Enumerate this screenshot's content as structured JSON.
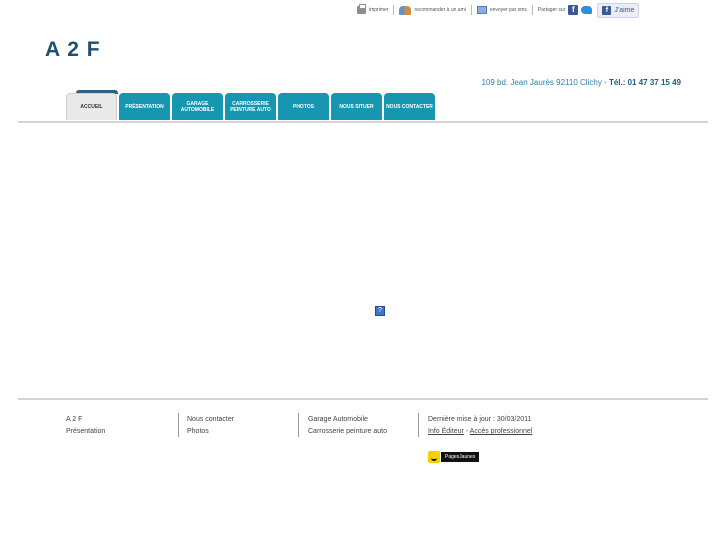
{
  "toolbar": {
    "print_label": "imprimer",
    "recommend_label": "recommander à un ami",
    "email_label": "envoyer par sms",
    "share_label": "Partager sur",
    "like_label": "J'aime",
    "facebook_letter": "f"
  },
  "site": {
    "logo": "A 2 F",
    "address": "109 bd. Jean Jaurès 92110 Clichy -",
    "tel": "Tél.: 01 47 37 15 49"
  },
  "nav": {
    "tabs": [
      {
        "label": "ACCUEIL"
      },
      {
        "label": "PRÉSENTATION"
      },
      {
        "label": "GARAGE AUTOMOBILE"
      },
      {
        "label": "CARROSSERIE PEINTURE AUTO"
      },
      {
        "label": "PHOTOS"
      },
      {
        "label": "NOUS SITUER"
      },
      {
        "label": "NOUS CONTACTER"
      }
    ]
  },
  "main": {
    "placeholder_glyph": "?"
  },
  "footer": {
    "col1": [
      "A 2 F",
      "Présentation"
    ],
    "col2": [
      "Nous contacter",
      "Photos"
    ],
    "col3": [
      "Garage Automobile",
      "Carrosserie peinture auto"
    ],
    "updated": "Dernière mise à jour : 30/03/2011",
    "info_editor": "Info Éditeur",
    "dash": "-",
    "pro_access": "Accès professionnel",
    "pagesjaunes": "PagesJaunes"
  },
  "colors": {
    "tab": "#1796b1",
    "logo": "#1f4e72",
    "address": "#2e7fa8"
  }
}
